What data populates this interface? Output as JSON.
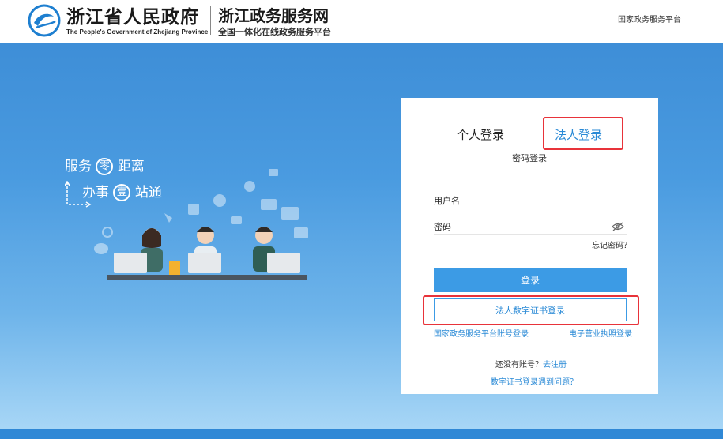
{
  "header": {
    "gov_title": "浙江省人民政府",
    "gov_subtitle": "The People's Government of Zhejiang Province",
    "site_title": "浙江政务服务网",
    "site_subtitle": "全国一体化在线政务服务平台",
    "national_platform_link": "国家政务服务平台"
  },
  "hero": {
    "slogan_line1": {
      "prefix": "服务",
      "circled": "零",
      "suffix": "距离"
    },
    "slogan_line2": {
      "prefix": "办事",
      "circled": "壹",
      "suffix": "站通"
    }
  },
  "login": {
    "tabs": [
      {
        "label": "个人登录",
        "active": false
      },
      {
        "label": "法人登录",
        "active": true,
        "highlighted": true
      }
    ],
    "mode_label": "密码登录",
    "username_label": "用户名",
    "username_value": "",
    "password_label": "密码",
    "password_value": "",
    "forgot_password": "忘记密码？",
    "login_button": "登录",
    "cert_login_button": "法人数字证书登录",
    "national_account_login": "国家政务服务平台账号登录",
    "business_license_login": "电子营业执照登录",
    "no_account_text": "还没有账号？",
    "register_link": "去注册",
    "cert_problem_link": "数字证书登录遇到问题？"
  },
  "colors": {
    "accent": "#2a8ad6",
    "button_bg": "#3c9be5",
    "highlight_border": "#e8333a",
    "hero_top": "#3e8ed7",
    "hero_bottom": "#a7d6f6"
  },
  "icons": [
    "zhejiang-logo-icon",
    "eye-hidden-icon"
  ]
}
